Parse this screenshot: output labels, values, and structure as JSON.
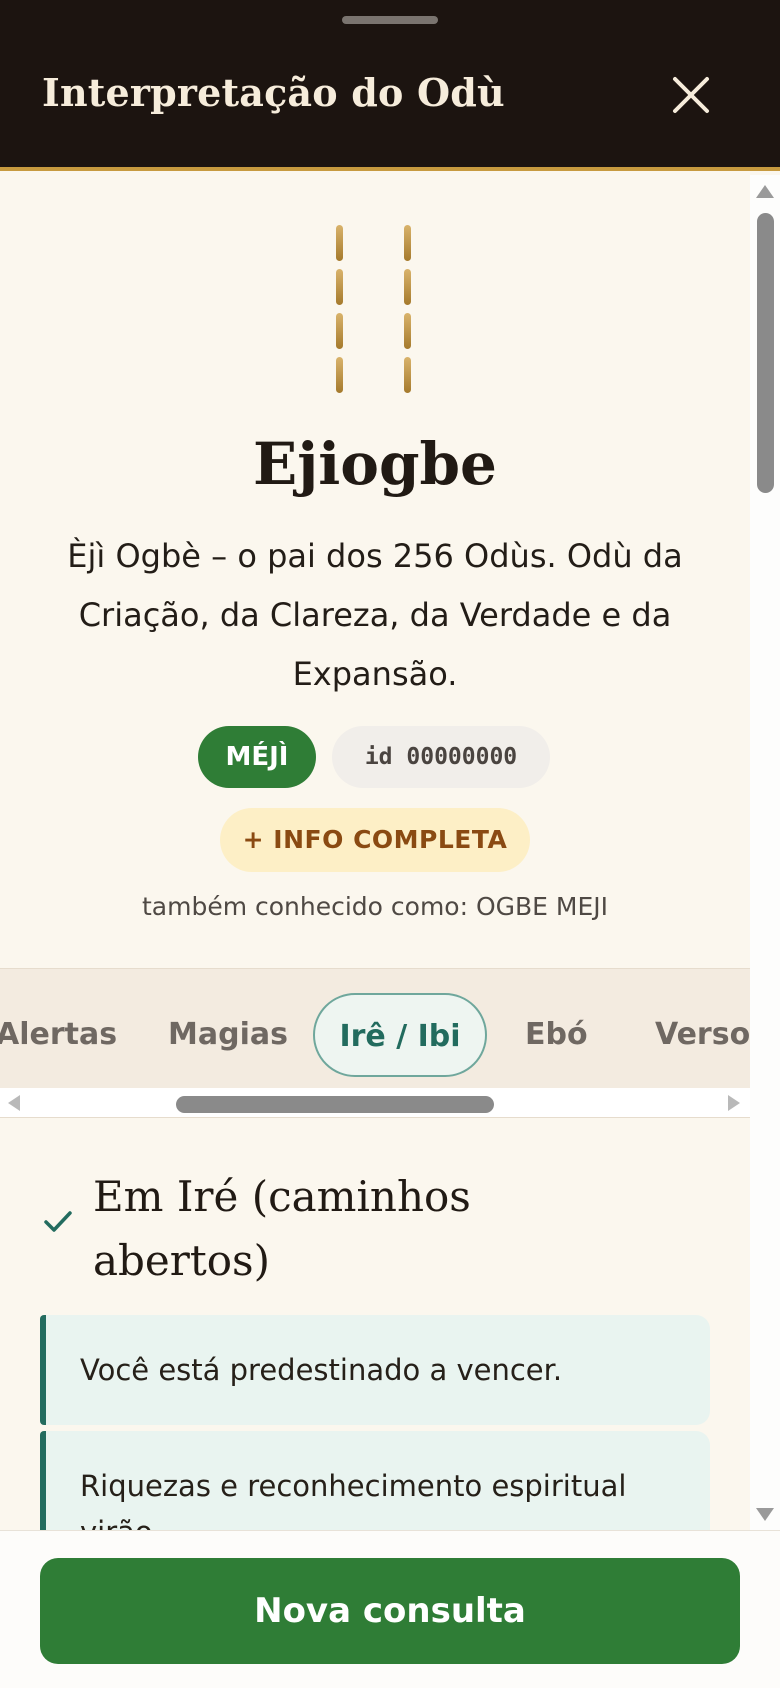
{
  "header": {
    "title": "Interpretação do Odù",
    "close_icon": "close-icon"
  },
  "odu": {
    "name": "Ejiogbe",
    "description": "Èjì Ogbè – o pai dos 256 Odùs. Odù da Criação, da Clareza, da Verdade e da Expansão.",
    "badge": "MÉJÌ",
    "id_label": "id 00000000",
    "info_button": "+ INFO COMPLETA",
    "aka": "também conhecido como: OGBE MEJI"
  },
  "tabs": [
    {
      "label": "Alertas",
      "active": false
    },
    {
      "label": "Magias",
      "active": false
    },
    {
      "label": "Irê / Ibi",
      "active": true
    },
    {
      "label": "Ebó",
      "active": false
    },
    {
      "label": "Versos",
      "active": false
    }
  ],
  "section": {
    "icon": "check-icon",
    "title": "Em Iré (caminhos abertos)",
    "items": [
      "Você está predestinado a vencer.",
      "Riquezas e reconhecimento espiritual virão."
    ]
  },
  "footer": {
    "new_consult": "Nova consulta"
  },
  "colors": {
    "header_bg": "#1c1410",
    "gold": "#c79a3f",
    "primary_green": "#2f7d36",
    "teal": "#236c5f",
    "background": "#fbf7ee"
  }
}
